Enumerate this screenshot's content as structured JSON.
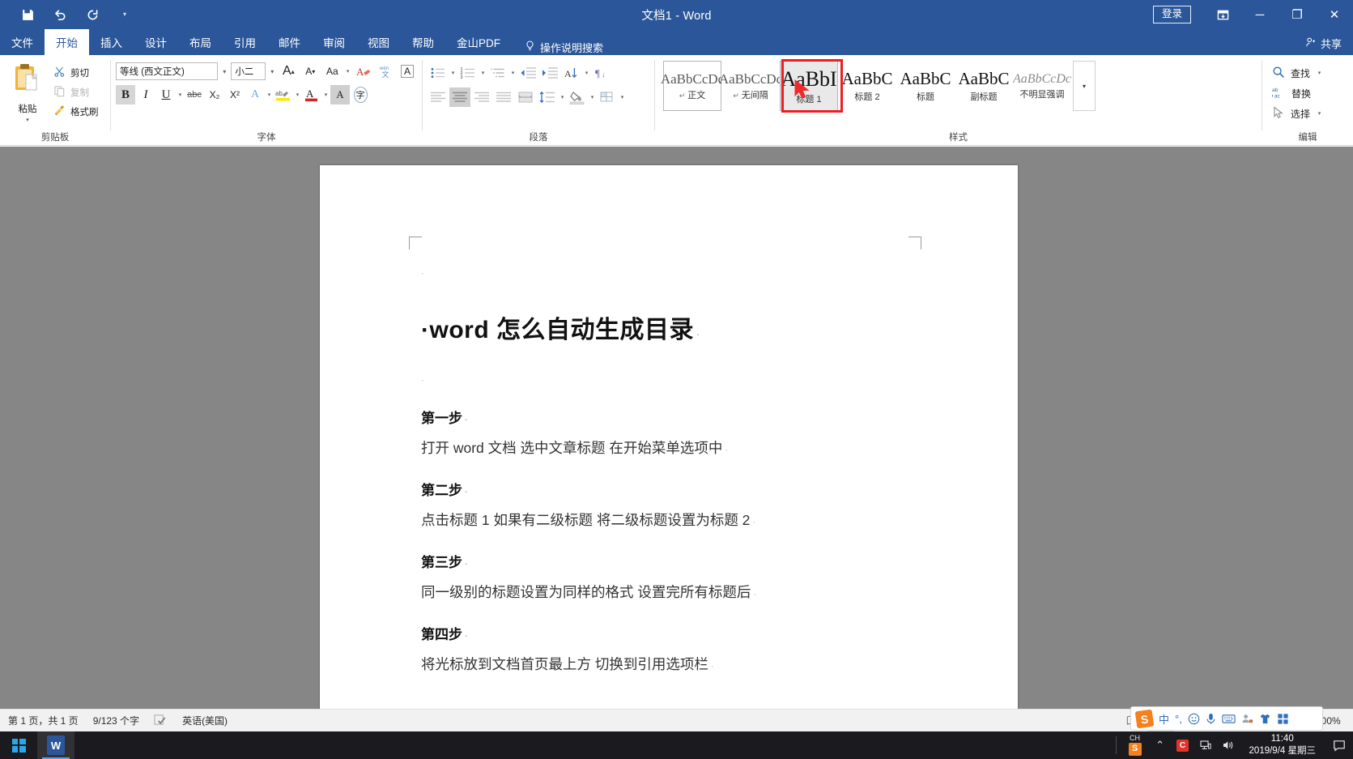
{
  "titlebar": {
    "title": "文档1  -  Word",
    "signin_label": "登录",
    "qat": [
      {
        "name": "save-icon",
        "label": "保存"
      },
      {
        "name": "undo-icon",
        "label": "撤消"
      },
      {
        "name": "redo-icon",
        "label": "恢复"
      },
      {
        "name": "customize-qat-caret",
        "label": "▾"
      }
    ],
    "ribbon_display_label": "⬓",
    "minimize_label": "─",
    "restore_label": "❐",
    "close_label": "✕",
    "share_label": "共享"
  },
  "tabs": [
    {
      "label": "文件",
      "active": false
    },
    {
      "label": "开始",
      "active": true
    },
    {
      "label": "插入",
      "active": false
    },
    {
      "label": "设计",
      "active": false
    },
    {
      "label": "布局",
      "active": false
    },
    {
      "label": "引用",
      "active": false
    },
    {
      "label": "邮件",
      "active": false
    },
    {
      "label": "审阅",
      "active": false
    },
    {
      "label": "视图",
      "active": false
    },
    {
      "label": "帮助",
      "active": false
    },
    {
      "label": "金山PDF",
      "active": false
    }
  ],
  "tell_me": "操作说明搜索",
  "ribbon": {
    "clipboard": {
      "group_label": "剪贴板",
      "paste_label": "粘贴",
      "items": [
        {
          "label": "剪切",
          "icon": "scissors-icon",
          "dim": false
        },
        {
          "label": "复制",
          "icon": "copy-icon",
          "dim": true
        },
        {
          "label": "格式刷",
          "icon": "format-painter-icon",
          "dim": false
        }
      ]
    },
    "font": {
      "group_label": "字体",
      "font_name": "等线 (西文正文)",
      "font_size": "小二",
      "grow_font": "A",
      "shrink_font": "A",
      "change_case": "Aa",
      "clear_formatting": "A",
      "phonetic_guide": "wén",
      "character_border": "A",
      "bold": "B",
      "italic": "I",
      "underline": "U",
      "strikethrough": "abc",
      "subscript": "X₂",
      "superscript": "X²",
      "text_effects": "A",
      "highlight": "ab",
      "font_color": "A",
      "char_shading": "A",
      "enclose_char": "字"
    },
    "paragraph": {
      "group_label": "段落",
      "bullets": "bullet-list-icon",
      "numbering": "numbered-list-icon",
      "multilevel": "multilevel-list-icon",
      "decrease_indent": "decrease-indent-icon",
      "increase_indent": "increase-indent-icon",
      "sort": "sort-icon",
      "show_marks": "show-marks-icon",
      "align_left": "align-left-icon",
      "align_center": "align-center-icon",
      "align_right": "align-right-icon",
      "justify": "justify-icon",
      "distribute": "distribute-icon",
      "line_spacing": "line-spacing-icon",
      "shading": "shading-icon",
      "borders": "borders-icon"
    },
    "styles": {
      "group_label": "样式",
      "more_label": "▾",
      "items": [
        {
          "preview": "AaBbCcDc",
          "name": "正文",
          "pilcrow": "↵",
          "state": "boxed",
          "kind": "body"
        },
        {
          "preview": "AaBbCcDc",
          "name": "无间隔",
          "pilcrow": "↵",
          "state": "normal",
          "kind": "body"
        },
        {
          "preview": "AaBbI",
          "name": "标题 1",
          "pilcrow": "",
          "state": "selected",
          "kind": "big"
        },
        {
          "preview": "AaBbC",
          "name": "标题 2",
          "pilcrow": "",
          "state": "normal",
          "kind": "h2"
        },
        {
          "preview": "AaBbC",
          "name": "标题",
          "pilcrow": "",
          "state": "normal",
          "kind": "t"
        },
        {
          "preview": "AaBbC",
          "name": "副标题",
          "pilcrow": "",
          "state": "normal",
          "kind": "sub"
        },
        {
          "preview": "AaBbCcDc",
          "name": "不明显强调",
          "pilcrow": "",
          "state": "normal",
          "kind": "em"
        }
      ]
    },
    "editing": {
      "group_label": "编辑",
      "items": [
        {
          "label": "查找",
          "icon": "search-icon",
          "caret": "▾"
        },
        {
          "label": "替换",
          "icon": "replace-icon",
          "caret": ""
        },
        {
          "label": "选择",
          "icon": "select-icon",
          "caret": "▾"
        }
      ]
    }
  },
  "document": {
    "title": "word 怎么自动生成目录",
    "title_leading_mark": "·",
    "blocks": [
      {
        "type": "heading",
        "text": "第一步"
      },
      {
        "type": "paragraph",
        "text": "打开 word 文档   选中文章标题 在开始菜单选项中"
      },
      {
        "type": "heading",
        "text": "第二步"
      },
      {
        "type": "paragraph",
        "text": "点击标题 1   如果有二级标题 将二级标题设置为标题 2"
      },
      {
        "type": "heading",
        "text": "第三步"
      },
      {
        "type": "paragraph",
        "text": "同一级别的标题设置为同样的格式   设置完所有标题后"
      },
      {
        "type": "heading",
        "text": "第四步"
      },
      {
        "type": "paragraph",
        "text": "将光标放到文档首页最上方   切换到引用选项栏"
      }
    ]
  },
  "statusbar": {
    "page_info": "第 1 页，共 1 页",
    "word_count": "9/123 个字",
    "proofing_icon": "proofing-icon",
    "language": "英语(美国)",
    "views": [
      {
        "name": "read-mode",
        "icon": "book-icon",
        "active": false
      },
      {
        "name": "print-layout",
        "icon": "page-icon",
        "active": true
      },
      {
        "name": "web-layout",
        "icon": "web-icon",
        "active": false
      }
    ],
    "zoom_out": "−",
    "zoom_in": "+",
    "zoom_value": "100%"
  },
  "ime_bar": {
    "logo": "S",
    "mode": "中",
    "punctuation": "°,",
    "emoji": "☺",
    "voice": "🎤",
    "keyboard": "⌨",
    "user": "👤",
    "skin": "👕",
    "toolbox": "▦"
  },
  "taskbar": {
    "start_label": "开始",
    "apps": [
      {
        "name": "word-taskbar-item",
        "label": "W"
      }
    ],
    "tray_ime": {
      "top": "CH",
      "bottom": "S"
    },
    "tray_icons": [
      {
        "name": "show-hidden-icons",
        "glyph": "⌃"
      },
      {
        "name": "app-red-icon",
        "glyph": "C"
      },
      {
        "name": "network-icon",
        "glyph": "🖧"
      },
      {
        "name": "volume-icon",
        "glyph": "🔊"
      }
    ],
    "clock_time": "11:40",
    "clock_date": "2019/9/4 星期三",
    "notification_icon": "notification-icon"
  }
}
